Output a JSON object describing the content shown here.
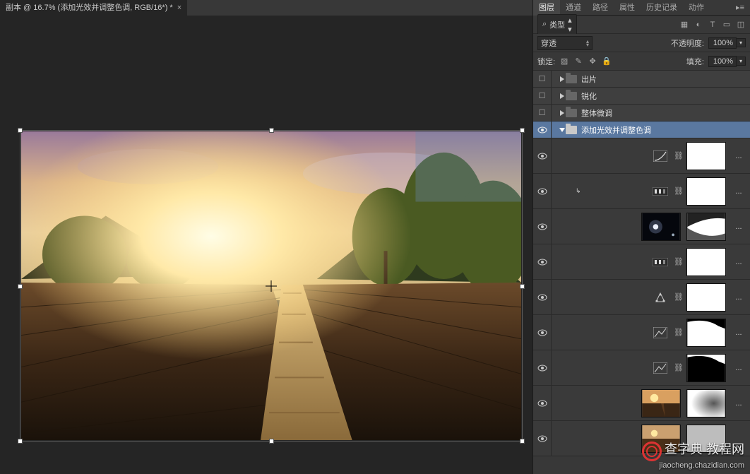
{
  "doc": {
    "title": "副本 @ 16.7% (添加光效并调整色调, RGB/16*) *",
    "close": "×"
  },
  "panel_tabs": {
    "layers": "图层",
    "channels": "通道",
    "paths": "路径",
    "properties": "属性",
    "history": "历史记录",
    "actions": "动作"
  },
  "filter": {
    "magnifier": "⌕",
    "label": "类型",
    "icon_image": "▦",
    "icon_adjust": "◐",
    "icon_text": "T",
    "icon_shape": "▭",
    "icon_smart": "◫"
  },
  "blend": {
    "mode": "穿透",
    "opacity_label": "不透明度:",
    "opacity_value": "100%"
  },
  "lock": {
    "label": "锁定:",
    "fill_label": "填充:",
    "fill_value": "100%"
  },
  "groups": {
    "g1": "出片",
    "g2": "锐化",
    "g3": "整体微调",
    "g4": "添加光效并调整色调"
  },
  "fx": "...",
  "icons": {
    "curves": "curves",
    "preset": "preset",
    "balance": "balance",
    "sat": "sat"
  },
  "watermark": {
    "line1": "查字典 教程网",
    "line2": "jiaocheng.chazidian.com"
  }
}
